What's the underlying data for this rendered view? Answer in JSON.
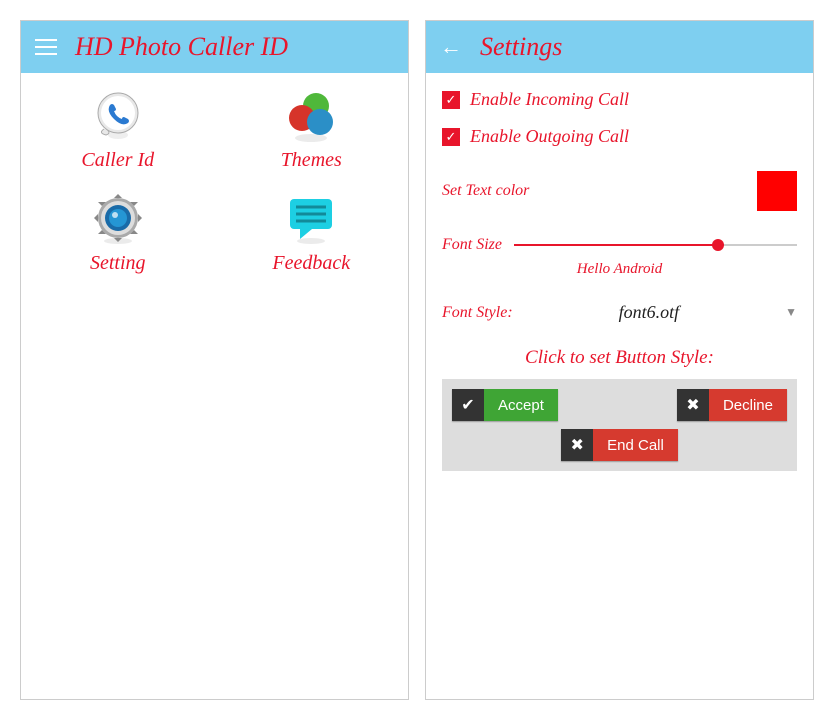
{
  "home": {
    "title": "HD Photo Caller ID",
    "items": [
      {
        "label": "Caller Id"
      },
      {
        "label": "Themes"
      },
      {
        "label": "Setting"
      },
      {
        "label": "Feedback"
      }
    ]
  },
  "settings": {
    "title": "Settings",
    "enableIncoming": "Enable Incoming Call",
    "enableOutgoing": "Enable Outgoing Call",
    "setTextColor": "Set Text color",
    "textColor": "#ff0000",
    "fontSize": "Font Size",
    "sliderCaption": "Hello Android",
    "fontStyle": "Font Style:",
    "fontStyleValue": "font6.otf",
    "buttonStyleTitle": "Click to set Button Style:",
    "buttons": {
      "accept": "Accept",
      "decline": "Decline",
      "endcall": "End Call"
    }
  }
}
